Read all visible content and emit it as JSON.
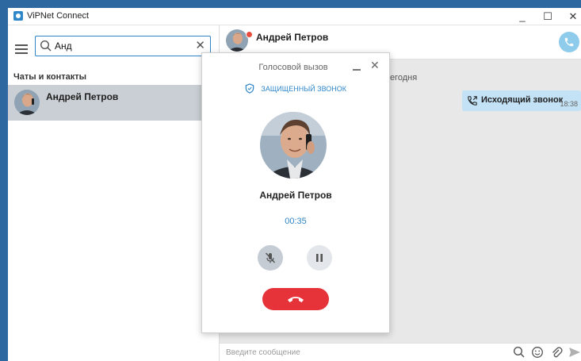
{
  "window": {
    "title": "ViPNet Connect",
    "controls": {
      "minimize": "_",
      "maximize": "☐",
      "close": "✕"
    }
  },
  "sidebar": {
    "search": {
      "value": "Анд",
      "clear": "✕"
    },
    "section_title": "Чаты и контакты",
    "contacts": [
      {
        "name": "Андрей Петров",
        "selected": true
      }
    ]
  },
  "chat": {
    "contact_name": "Андрей Петров",
    "date_label": "Сегодня",
    "messages": [
      {
        "text": "Исходящий звонок",
        "time": "18:38",
        "icon": "outgoing-call-icon"
      }
    ],
    "compose": {
      "placeholder": "Введите сообщение"
    }
  },
  "call_dialog": {
    "title": "Голосовой вызов",
    "secure_label": "ЗАЩИЩЕННЫЙ ЗВОНОК",
    "contact_name": "Андрей Петров",
    "timer": "00:35",
    "close": "✕"
  },
  "colors": {
    "accent": "#2f86c9",
    "selected_row": "#c9cfd4",
    "bubble": "#c3e2f5",
    "hangup": "#e6333a",
    "desktop": "#2d69a0"
  }
}
